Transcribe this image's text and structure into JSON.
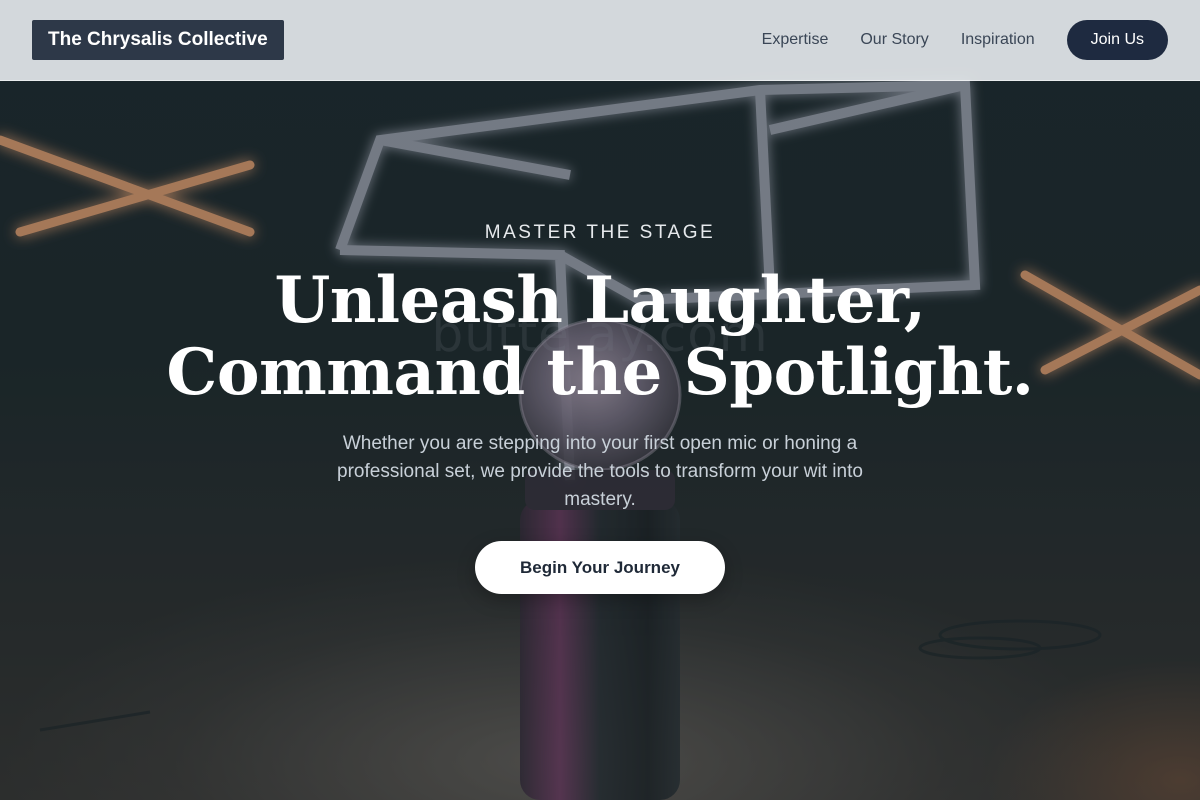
{
  "header": {
    "brand": "The Chrysalis Collective",
    "nav_links": [
      "Expertise",
      "Our Story",
      "Inspiration"
    ],
    "cta_label": "Join Us"
  },
  "hero": {
    "eyebrow": "MASTER THE STAGE",
    "headline_line1": "Unleash Laughter,",
    "headline_line2": "Command the Spotlight.",
    "subtext": "Whether you are stepping into your first open mic or honing a professional set, we provide the tools to transform your wit into mastery.",
    "cta_label": "Begin Your Journey"
  },
  "watermark": "butte        ay.com",
  "colors": {
    "brand_bg": "#2d3848",
    "header_bg": "#e2e6e9",
    "primary_button": "#1e2a40",
    "hero_button": "#ffffff",
    "neon_orange": "#ff8a4a"
  },
  "background_image": {
    "subject": "stage-microphone-neon-lights"
  }
}
